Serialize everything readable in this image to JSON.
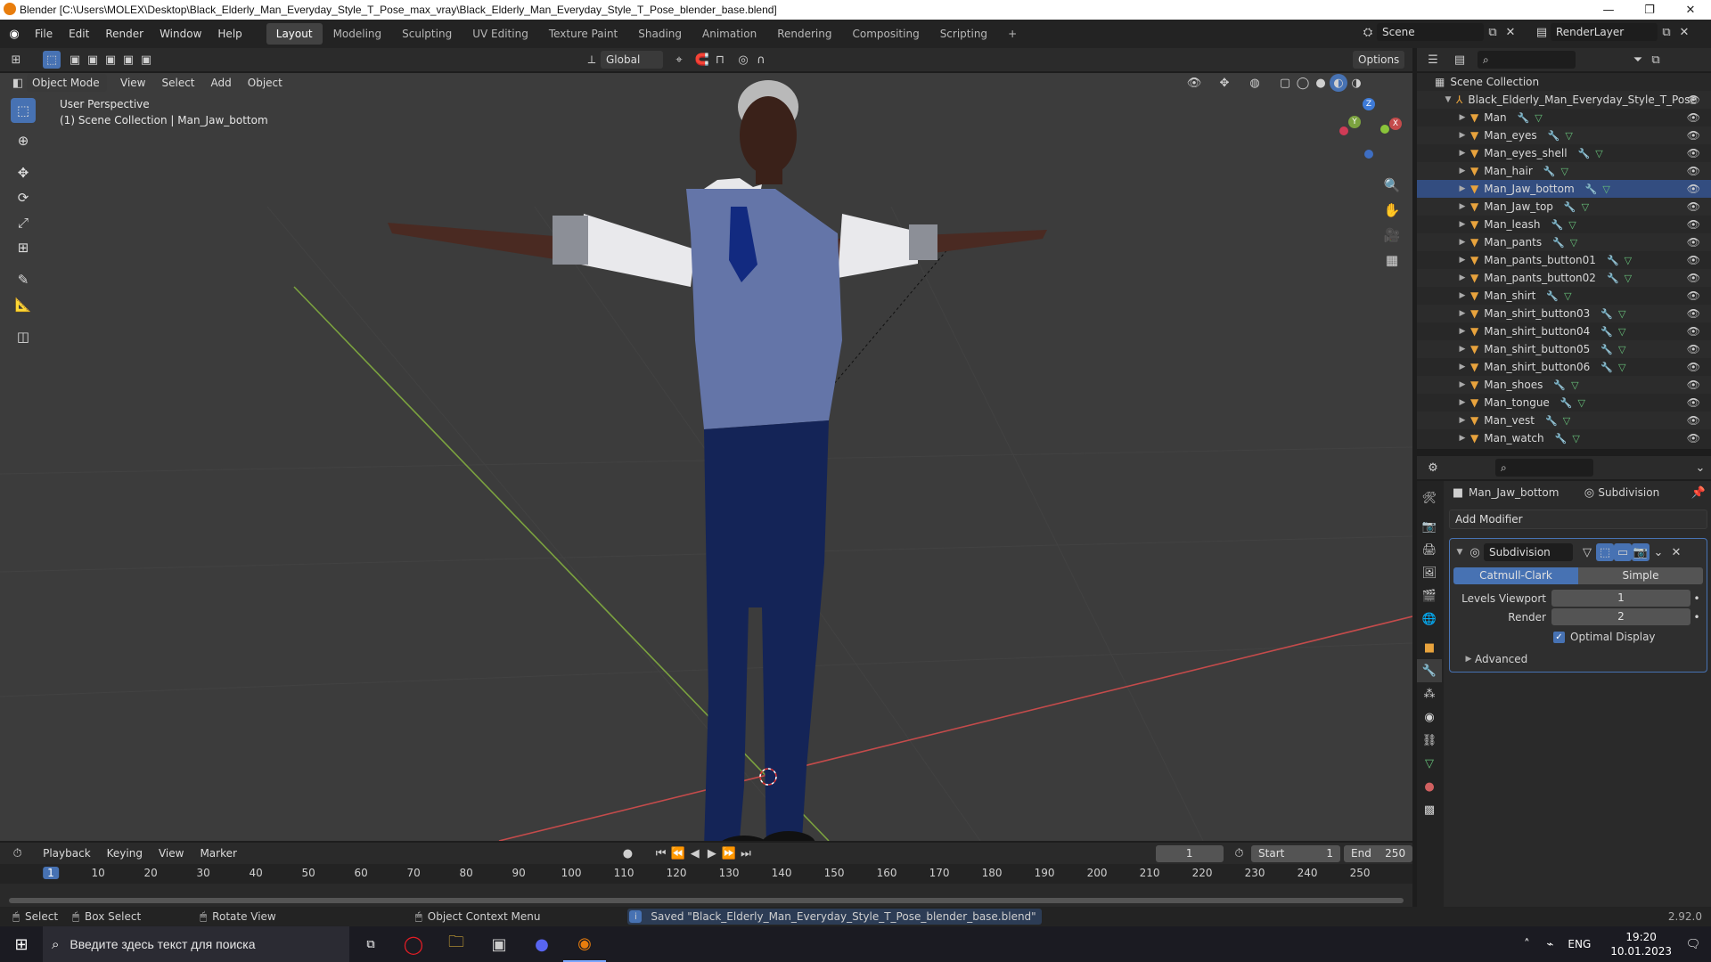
{
  "window": {
    "title": "Blender [C:\\Users\\MOLEX\\Desktop\\Black_Elderly_Man_Everyday_Style_T_Pose_max_vray\\Black_Elderly_Man_Everyday_Style_T_Pose_blender_base.blend]",
    "min": "—",
    "max": "❐",
    "close": "✕"
  },
  "menu": {
    "items": [
      "File",
      "Edit",
      "Render",
      "Window",
      "Help"
    ],
    "workspaces": [
      "Layout",
      "Modeling",
      "Sculpting",
      "UV Editing",
      "Texture Paint",
      "Shading",
      "Animation",
      "Rendering",
      "Compositing",
      "Scripting"
    ],
    "add_tab": "+",
    "scene": "Scene",
    "view_layer": "RenderLayer"
  },
  "viewport_header": {
    "mode": "Object Mode",
    "menus": [
      "View",
      "Select",
      "Add",
      "Object"
    ],
    "orientation": "Global",
    "options": "Options"
  },
  "viewport": {
    "perspective": "User Perspective",
    "context": "(1) Scene Collection | Man_Jaw_bottom",
    "gizmo": {
      "x": "X",
      "y": "Y",
      "z": "Z"
    }
  },
  "outliner": {
    "scene_collection": "Scene Collection",
    "root": "Black_Elderly_Man_Everyday_Style_T_Pose",
    "objects": [
      "Man",
      "Man_eyes",
      "Man_eyes_shell",
      "Man_hair",
      "Man_Jaw_bottom",
      "Man_Jaw_top",
      "Man_leash",
      "Man_pants",
      "Man_pants_button01",
      "Man_pants_button02",
      "Man_shirt",
      "Man_shirt_button03",
      "Man_shirt_button04",
      "Man_shirt_button05",
      "Man_shirt_button06",
      "Man_shoes",
      "Man_tongue",
      "Man_vest",
      "Man_watch"
    ]
  },
  "properties": {
    "object": "Man_Jaw_bottom",
    "modifier_breadcrumb": "Subdivision",
    "add_modifier": "Add Modifier",
    "modifier_name": "Subdivision",
    "catmull": "Catmull-Clark",
    "simple": "Simple",
    "levels_label": "Levels Viewport",
    "levels_value": "1",
    "render_label": "Render",
    "render_value": "2",
    "optimal_display": "Optimal Display",
    "advanced": "Advanced"
  },
  "timeline": {
    "menus": [
      "Playback",
      "Keying",
      "View",
      "Marker"
    ],
    "current_frame": "1",
    "start_label": "Start",
    "start": "1",
    "end_label": "End",
    "end": "250",
    "ticks": [
      "1",
      "10",
      "20",
      "30",
      "40",
      "50",
      "60",
      "70",
      "80",
      "90",
      "100",
      "110",
      "120",
      "130",
      "140",
      "150",
      "160",
      "170",
      "180",
      "190",
      "200",
      "210",
      "220",
      "230",
      "240",
      "250"
    ]
  },
  "status": {
    "select": "Select",
    "box_select": "Box Select",
    "rotate_view": "Rotate View",
    "context_menu": "Object Context Menu",
    "saved": "Saved \"Black_Elderly_Man_Everyday_Style_T_Pose_blender_base.blend\"",
    "version": "2.92.0"
  },
  "taskbar": {
    "search_placeholder": "Введите здесь текст для поиска",
    "lang": "ENG",
    "time": "19:20",
    "date": "10.01.2023"
  },
  "colors": {
    "accent": "#4772b3",
    "viewport_bg": "#3c3c3c",
    "object_orange": "#e8a33d",
    "axis_red": "#c44b4b",
    "axis_green": "#7ba23f"
  }
}
